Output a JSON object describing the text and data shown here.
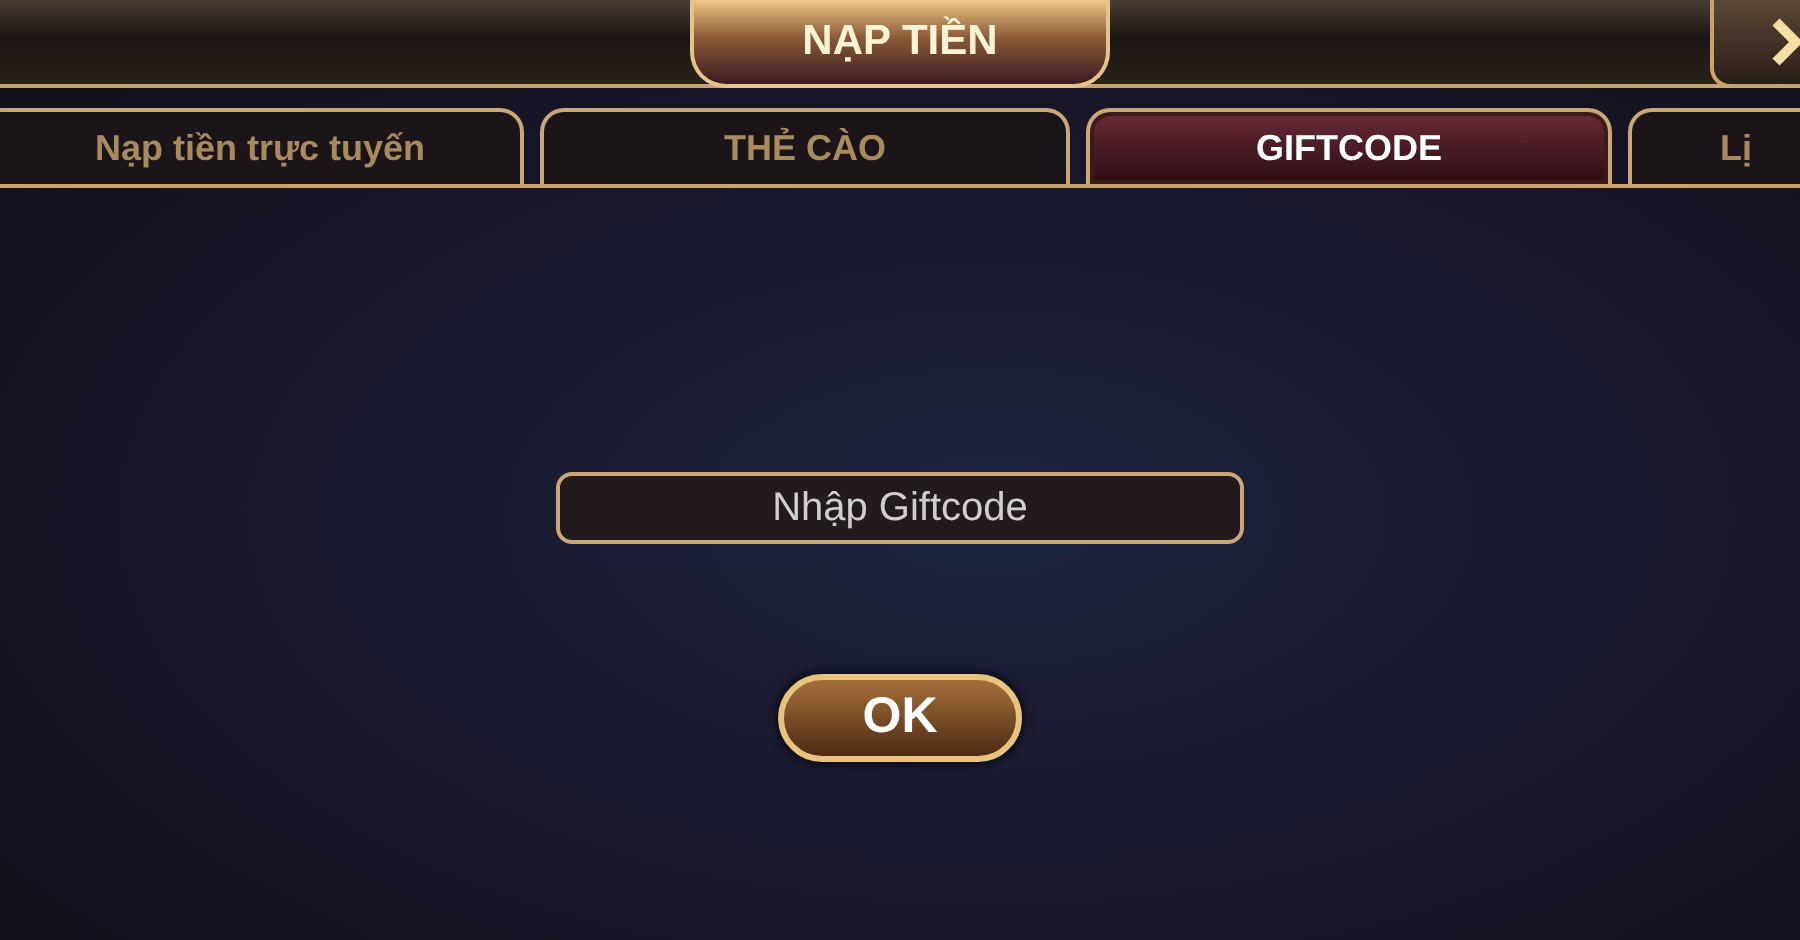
{
  "window": {
    "title": "NẠP TIỀN"
  },
  "tabs": [
    {
      "label": "Nạp tiền trực tuyến",
      "selected": false
    },
    {
      "label": "THẺ CÀO",
      "selected": false
    },
    {
      "label": "GIFTCODE",
      "selected": true
    },
    {
      "label": "Lị",
      "selected": false
    }
  ],
  "giftcode_field": {
    "placeholder": "Nhập Giftcode"
  },
  "ok_button": {
    "label": "OK"
  }
}
